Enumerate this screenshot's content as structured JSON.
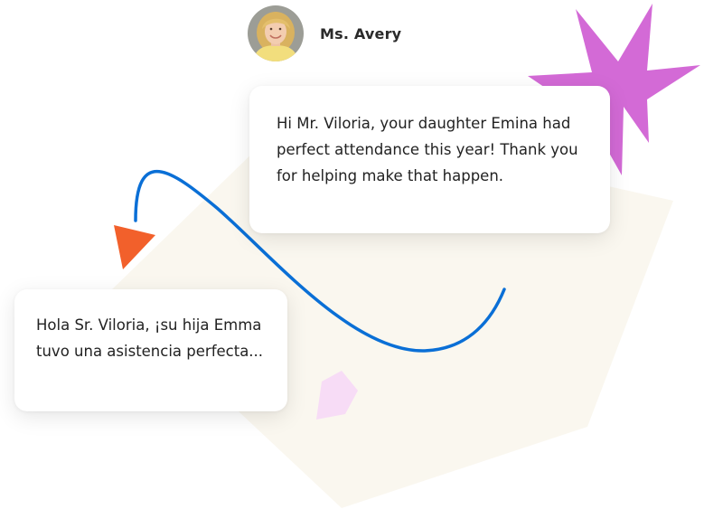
{
  "sender": {
    "name": "Ms. Avery",
    "avatar_icon": "teacher-avatar-photo"
  },
  "messages": {
    "original": {
      "text": "Hi Mr. Viloria, your daughter Emina had perfect attendance this year! Thank you for helping make that happen."
    },
    "translated": {
      "text": "Hola Sr. Viloria, ¡su hija Emma tuvo una asistencia perfecta..."
    }
  },
  "decorations": {
    "arrow_icon": "translate-arrow-icon",
    "star_icon": "sparkle-star-icon",
    "pentagon_icon": "pentagon-shape-icon",
    "colors": {
      "arrow": "#0a6fd6",
      "arrowhead": "#f2602b",
      "star": "#d36ad6",
      "backdrop": "#faf7ef",
      "pentagon": "#f7dcf6"
    }
  }
}
